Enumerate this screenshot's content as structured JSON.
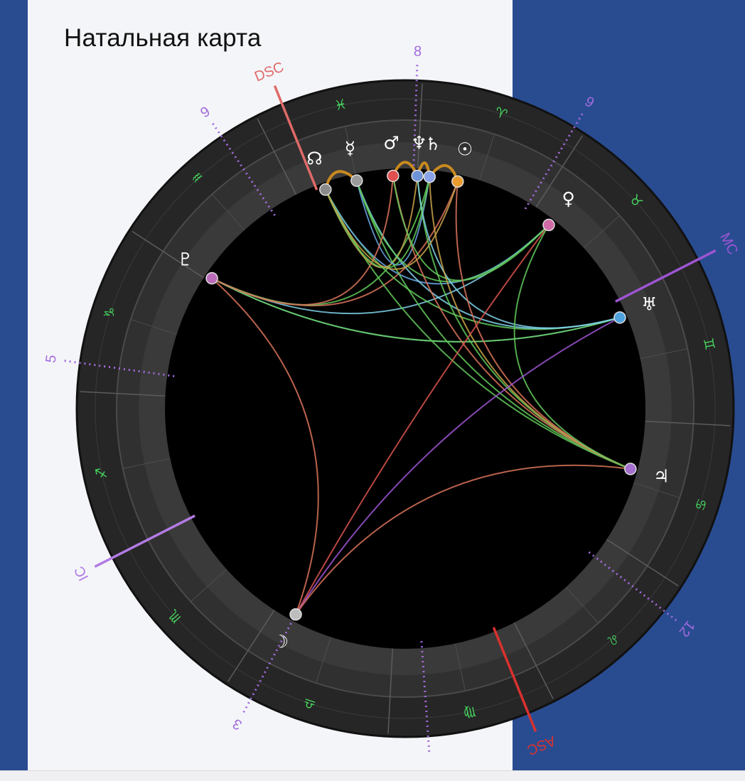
{
  "header": {
    "title": "Натальная карта"
  },
  "colors": {
    "page_bg": "#294c91",
    "card_bg": "#f4f5f9",
    "zodiac": "#46d65f",
    "house": "#a26bdc",
    "asc_dsc": "#d9312f",
    "mc_ic": "#9d55d2"
  },
  "axes": [
    {
      "name": "asc-label",
      "label": "ASC",
      "angle": 68,
      "color": "#d9312f"
    },
    {
      "name": "dsc-label",
      "label": "DSC",
      "angle": 248,
      "color": "#e06a68"
    },
    {
      "name": "mc-label",
      "label": "MC",
      "angle": 333,
      "color": "#9d55d2"
    },
    {
      "name": "ic-label",
      "label": "IC",
      "angle": 153,
      "color": "#b27be4"
    }
  ],
  "houses": [
    {
      "label": "9",
      "angle": 236
    },
    {
      "label": "8",
      "angle": 272
    },
    {
      "label": "9",
      "angle": 301
    },
    {
      "label": "5",
      "angle": 188
    },
    {
      "label": "12",
      "angle": 38
    },
    {
      "label": "3",
      "angle": 118
    },
    {
      "label": "",
      "angle": 86
    }
  ],
  "zodiac_signs": [
    {
      "name": "pisces-sign",
      "glyph": "♓",
      "angle": 258
    },
    {
      "name": "aries-sign",
      "glyph": "♈",
      "angle": 288
    },
    {
      "name": "taurus-sign",
      "glyph": "♉",
      "angle": 318
    },
    {
      "name": "gemini-sign",
      "glyph": "♊",
      "angle": 348
    },
    {
      "name": "cancer-sign",
      "glyph": "♋",
      "angle": 18
    },
    {
      "name": "leo-sign",
      "glyph": "♌",
      "angle": 48
    },
    {
      "name": "virgo-sign",
      "glyph": "♍",
      "angle": 78
    },
    {
      "name": "libra-sign",
      "glyph": "♎",
      "angle": 108
    },
    {
      "name": "scorpio-sign",
      "glyph": "♏",
      "angle": 138
    },
    {
      "name": "sagittarius-sign",
      "glyph": "♐",
      "angle": 168
    },
    {
      "name": "capricorn-sign",
      "glyph": "♑",
      "angle": 198
    },
    {
      "name": "aquarius-sign",
      "glyph": "♒",
      "angle": 228
    }
  ],
  "planets": [
    {
      "name": "node",
      "glyph": "☊",
      "angle": 250,
      "dot": "#8a8a8a"
    },
    {
      "name": "mercury",
      "glyph": "☿",
      "angle": 258,
      "dot": "#9a9a9a"
    },
    {
      "name": "mars",
      "glyph": "♂",
      "angle": 267,
      "dot": "#e0504e"
    },
    {
      "name": "neptune",
      "glyph": "♆",
      "angle": 273,
      "dot": "#6f93d8"
    },
    {
      "name": "saturn",
      "glyph": "♄",
      "angle": 276,
      "dot": "#8aa2e8"
    },
    {
      "name": "sun",
      "glyph": "☉",
      "angle": 283,
      "dot": "#e89b2c"
    },
    {
      "name": "venus",
      "glyph": "♀",
      "angle": 308,
      "dot": "#d06aa6"
    },
    {
      "name": "uranus",
      "glyph": "♅",
      "angle": 337,
      "dot": "#4fa2de"
    },
    {
      "name": "jupiter",
      "glyph": "♃",
      "angle": 15,
      "dot": "#a46fcd"
    },
    {
      "name": "moon",
      "glyph": "☽",
      "angle": 118,
      "dot": "#bdbdbd"
    },
    {
      "name": "pluto",
      "glyph": "♇",
      "angle": 214,
      "dot": "#bb6cb9"
    }
  ],
  "conjunctions": [
    [
      "node",
      "mercury"
    ],
    [
      "mars",
      "neptune"
    ],
    [
      "neptune",
      "saturn"
    ],
    [
      "saturn",
      "sun"
    ]
  ],
  "aspects": [
    {
      "from": "pluto",
      "to": "venus",
      "color": "#7fd0e6"
    },
    {
      "from": "pluto",
      "to": "uranus",
      "color": "#7fd0e6"
    },
    {
      "from": "pluto",
      "to": "uranus",
      "color": "#62c95a"
    },
    {
      "from": "pluto",
      "to": "moon",
      "color": "#d9735a"
    },
    {
      "from": "pluto",
      "to": "sun",
      "color": "#d9735a"
    },
    {
      "from": "pluto",
      "to": "saturn",
      "color": "#62c95a"
    },
    {
      "from": "node",
      "to": "uranus",
      "color": "#62c95a"
    },
    {
      "from": "node",
      "to": "venus",
      "color": "#6aa8e6"
    },
    {
      "from": "node",
      "to": "jupiter",
      "color": "#62c95a"
    },
    {
      "from": "node",
      "to": "neptune",
      "color": "#c9a24a"
    },
    {
      "from": "mercury",
      "to": "uranus",
      "color": "#7fd0e6"
    },
    {
      "from": "mercury",
      "to": "jupiter",
      "color": "#62c95a"
    },
    {
      "from": "mercury",
      "to": "saturn",
      "color": "#6aa8e6"
    },
    {
      "from": "mercury",
      "to": "venus",
      "color": "#62c95a"
    },
    {
      "from": "mars",
      "to": "jupiter",
      "color": "#d9735a"
    },
    {
      "from": "mars",
      "to": "pluto",
      "color": "#d9735a"
    },
    {
      "from": "mars",
      "to": "venus",
      "color": "#62c95a"
    },
    {
      "from": "neptune",
      "to": "jupiter",
      "color": "#62c95a"
    },
    {
      "from": "neptune",
      "to": "uranus",
      "color": "#7fd0e6"
    },
    {
      "from": "saturn",
      "to": "jupiter",
      "color": "#c9a24a"
    },
    {
      "from": "saturn",
      "to": "node",
      "color": "#62c95a"
    },
    {
      "from": "sun",
      "to": "jupiter",
      "color": "#d9735a"
    },
    {
      "from": "sun",
      "to": "node",
      "color": "#c9a24a"
    },
    {
      "from": "venus",
      "to": "moon",
      "color": "#d9534f"
    },
    {
      "from": "venus",
      "to": "jupiter",
      "color": "#62c95a"
    },
    {
      "from": "uranus",
      "to": "moon",
      "color": "#9d55d2"
    },
    {
      "from": "jupiter",
      "to": "moon",
      "color": "#d9735a"
    }
  ]
}
